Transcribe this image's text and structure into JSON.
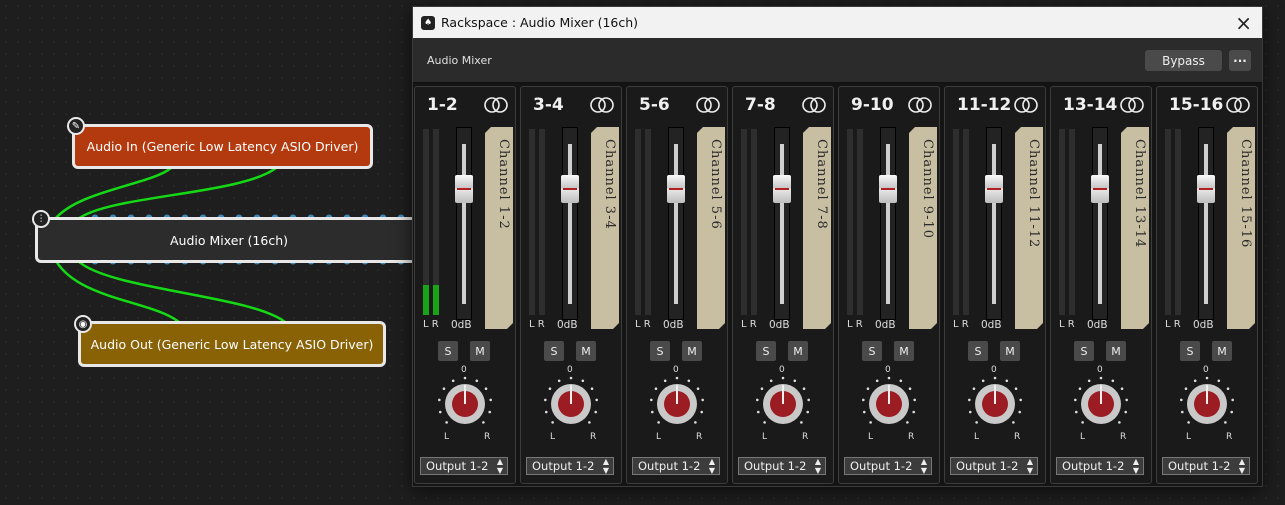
{
  "canvas": {
    "audio_in_label": "Audio In (Generic Low Latency ASIO Driver)",
    "mixer_label": "Audio Mixer (16ch)",
    "audio_out_label": "Audio Out (Generic Low Latency ASIO Driver)",
    "audio_in_color": "#b33a0e",
    "audio_out_color": "#8a6206",
    "wire_color": "#16d916",
    "pin_color": "#3e88b8"
  },
  "window": {
    "title": "Rackspace : Audio Mixer (16ch)",
    "close_icon": "×",
    "plugin_name": "Audio Mixer",
    "bypass_label": "Bypass",
    "more_label": "···"
  },
  "strips": [
    {
      "name": "1-2",
      "label": "Channel 1-2",
      "lr": "L R",
      "db": "0dB",
      "solo": "S",
      "mute": "M",
      "pan_center": "0",
      "pan_left": "L",
      "pan_right": "R",
      "output": "Output 1-2",
      "meter_level": 0.16
    },
    {
      "name": "3-4",
      "label": "Channel 3-4",
      "lr": "L R",
      "db": "0dB",
      "solo": "S",
      "mute": "M",
      "pan_center": "0",
      "pan_left": "L",
      "pan_right": "R",
      "output": "Output 1-2",
      "meter_level": 0
    },
    {
      "name": "5-6",
      "label": "Channel 5-6",
      "lr": "L R",
      "db": "0dB",
      "solo": "S",
      "mute": "M",
      "pan_center": "0",
      "pan_left": "L",
      "pan_right": "R",
      "output": "Output 1-2",
      "meter_level": 0
    },
    {
      "name": "7-8",
      "label": "Channel 7-8",
      "lr": "L R",
      "db": "0dB",
      "solo": "S",
      "mute": "M",
      "pan_center": "0",
      "pan_left": "L",
      "pan_right": "R",
      "output": "Output 1-2",
      "meter_level": 0
    },
    {
      "name": "9-10",
      "label": "Channel 9-10",
      "lr": "L R",
      "db": "0dB",
      "solo": "S",
      "mute": "M",
      "pan_center": "0",
      "pan_left": "L",
      "pan_right": "R",
      "output": "Output 1-2",
      "meter_level": 0
    },
    {
      "name": "11-12",
      "label": "Channel 11-12",
      "lr": "L R",
      "db": "0dB",
      "solo": "S",
      "mute": "M",
      "pan_center": "0",
      "pan_left": "L",
      "pan_right": "R",
      "output": "Output 1-2",
      "meter_level": 0
    },
    {
      "name": "13-14",
      "label": "Channel 13-14",
      "lr": "L R",
      "db": "0dB",
      "solo": "S",
      "mute": "M",
      "pan_center": "0",
      "pan_left": "L",
      "pan_right": "R",
      "output": "Output 1-2",
      "meter_level": 0
    },
    {
      "name": "15-16",
      "label": "Channel 15-16",
      "lr": "L R",
      "db": "0dB",
      "solo": "S",
      "mute": "M",
      "pan_center": "0",
      "pan_left": "L",
      "pan_right": "R",
      "output": "Output 1-2",
      "meter_level": 0
    }
  ]
}
